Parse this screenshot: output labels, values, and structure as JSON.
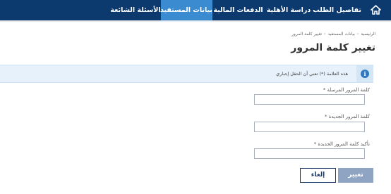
{
  "nav": {
    "home_icon": "home-icon",
    "items": [
      {
        "label": "تفاصيل الطلب",
        "active": false
      },
      {
        "label": "دراسة الأهلية",
        "active": false
      },
      {
        "label": "الدفعات المالية",
        "active": false
      },
      {
        "label": "بيانات المستفيد",
        "active": true
      },
      {
        "label": "الأسئلة الشائعة",
        "active": false
      }
    ]
  },
  "breadcrumb": [
    "الرئيسية",
    "بيانات المستفيد",
    "تغيير كلمة المرور"
  ],
  "page": {
    "title": "تغيير كلمة المرور"
  },
  "notice": {
    "icon": "info-icon",
    "text": "هذه العلامة (*) تعني أن الحقل إجباري"
  },
  "form": {
    "fields": [
      {
        "label": "كلمة المرور المرسلة",
        "required_mark": "*",
        "value": ""
      },
      {
        "label": "كلمة المرور الجديدة",
        "required_mark": "*",
        "value": ""
      },
      {
        "label": "تأكيد كلمة المرور الجديدة",
        "required_mark": "*",
        "value": ""
      }
    ]
  },
  "buttons": {
    "submit": "تغيير",
    "cancel": "إلغاء"
  },
  "colors": {
    "nav_bg": "#0d3a6e",
    "nav_active": "#3b8bd0",
    "notice_bg": "#e6f1fb",
    "primary_btn": "#8fa3c2"
  }
}
